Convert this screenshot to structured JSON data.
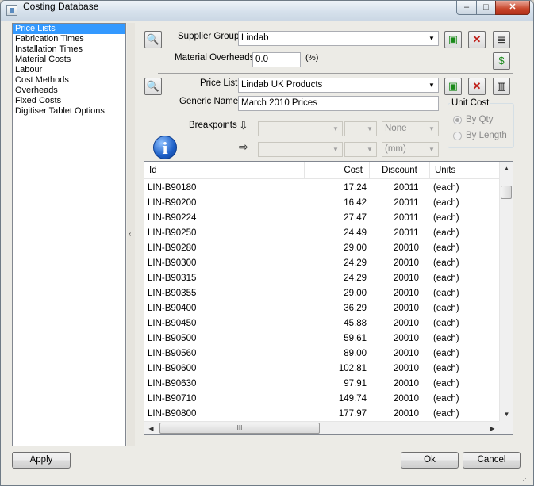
{
  "window": {
    "title": "Costing Database",
    "minimize": "–",
    "maximize": "□",
    "close": "✕"
  },
  "sidebar": {
    "items": [
      {
        "label": "Price Lists"
      },
      {
        "label": "Fabrication Times"
      },
      {
        "label": "Installation Times"
      },
      {
        "label": "Material Costs"
      },
      {
        "label": "Labour"
      },
      {
        "label": "Cost Methods"
      },
      {
        "label": "Overheads"
      },
      {
        "label": "Fixed Costs"
      },
      {
        "label": "Digitiser Tablet Options"
      }
    ],
    "selected": "Price Lists",
    "collapse_glyph": "‹"
  },
  "supplier": {
    "label": "Supplier Group",
    "value": "Lindab",
    "overheads_label": "Material Overheads",
    "overheads_value": "0.0",
    "overheads_unit": "(%)"
  },
  "pricelist": {
    "label": "Price List",
    "value": "Lindab UK Products",
    "generic_label": "Generic Name",
    "generic_value": "March 2010 Prices"
  },
  "unit_cost": {
    "title": "Unit Cost",
    "options": [
      "By Qty",
      "By Length"
    ],
    "selected": "By Qty"
  },
  "breakpoints": {
    "label": "Breakpoints",
    "row1_unit": "None",
    "row2_unit": "(mm)"
  },
  "icons": {
    "info": "info-icon",
    "down_arrow": "⇩",
    "right_arrow": "⇨"
  },
  "table": {
    "columns": [
      "Id",
      "Cost",
      "Discount",
      "Units"
    ],
    "rows": [
      {
        "id": "LIN-B90180",
        "cost": "17.24",
        "discount": "20011",
        "units": "(each)"
      },
      {
        "id": "LIN-B90200",
        "cost": "16.42",
        "discount": "20011",
        "units": "(each)"
      },
      {
        "id": "LIN-B90224",
        "cost": "27.47",
        "discount": "20011",
        "units": "(each)"
      },
      {
        "id": "LIN-B90250",
        "cost": "24.49",
        "discount": "20011",
        "units": "(each)"
      },
      {
        "id": "LIN-B90280",
        "cost": "29.00",
        "discount": "20010",
        "units": "(each)"
      },
      {
        "id": "LIN-B90300",
        "cost": "24.29",
        "discount": "20010",
        "units": "(each)"
      },
      {
        "id": "LIN-B90315",
        "cost": "24.29",
        "discount": "20010",
        "units": "(each)"
      },
      {
        "id": "LIN-B90355",
        "cost": "29.00",
        "discount": "20010",
        "units": "(each)"
      },
      {
        "id": "LIN-B90400",
        "cost": "36.29",
        "discount": "20010",
        "units": "(each)"
      },
      {
        "id": "LIN-B90450",
        "cost": "45.88",
        "discount": "20010",
        "units": "(each)"
      },
      {
        "id": "LIN-B90500",
        "cost": "59.61",
        "discount": "20010",
        "units": "(each)"
      },
      {
        "id": "LIN-B90560",
        "cost": "89.00",
        "discount": "20010",
        "units": "(each)"
      },
      {
        "id": "LIN-B90600",
        "cost": "102.81",
        "discount": "20010",
        "units": "(each)"
      },
      {
        "id": "LIN-B90630",
        "cost": "97.91",
        "discount": "20010",
        "units": "(each)"
      },
      {
        "id": "LIN-B90710",
        "cost": "149.74",
        "discount": "20010",
        "units": "(each)"
      },
      {
        "id": "LIN-B90800",
        "cost": "177.97",
        "discount": "20010",
        "units": "(each)"
      }
    ],
    "hscroll_grip": "III"
  },
  "buttons": {
    "apply": "Apply",
    "ok": "Ok",
    "cancel": "Cancel"
  }
}
